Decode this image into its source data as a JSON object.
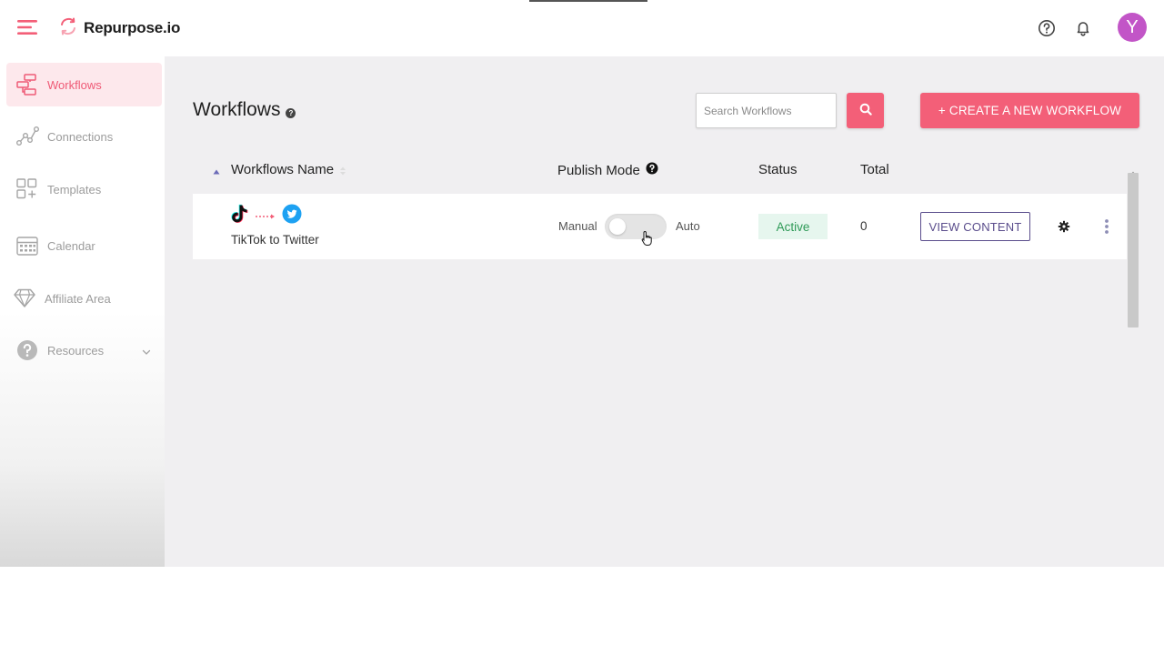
{
  "brand": {
    "name": "Repurpose.io"
  },
  "user": {
    "avatar_initial": "Y"
  },
  "sidebar": {
    "items": [
      {
        "label": "Workflows",
        "icon": "workflows-icon",
        "active": true
      },
      {
        "label": "Connections",
        "icon": "connections-icon"
      },
      {
        "label": "Templates",
        "icon": "templates-icon"
      },
      {
        "label": "Calendar",
        "icon": "calendar-icon"
      },
      {
        "label": "Affiliate Area",
        "icon": "diamond-icon"
      },
      {
        "label": "Resources",
        "icon": "question-circle-icon",
        "has_dropdown": true
      }
    ]
  },
  "main": {
    "title": "Workflows",
    "search": {
      "placeholder": "Search Workflows",
      "value": ""
    },
    "create_button_label": "+ CREATE A NEW WORKFLOW",
    "table": {
      "headers": {
        "name": "Workflows Name",
        "publish_mode": "Publish Mode",
        "status": "Status",
        "total": "Total"
      },
      "rows": [
        {
          "source_icon": "tiktok-icon",
          "destination_icon": "twitter-icon",
          "name": "TikTok to Twitter",
          "mode_off_label": "Manual",
          "mode_on_label": "Auto",
          "auto_enabled": false,
          "status": "Active",
          "total": "0",
          "view_label": "VIEW CONTENT"
        }
      ]
    }
  },
  "colors": {
    "accent": "#f35f78",
    "active_sidebar_bg": "#fde8ec",
    "status_green": "#2e9a57",
    "view_button": "#5a4d8c",
    "avatar": "#c255c7"
  }
}
